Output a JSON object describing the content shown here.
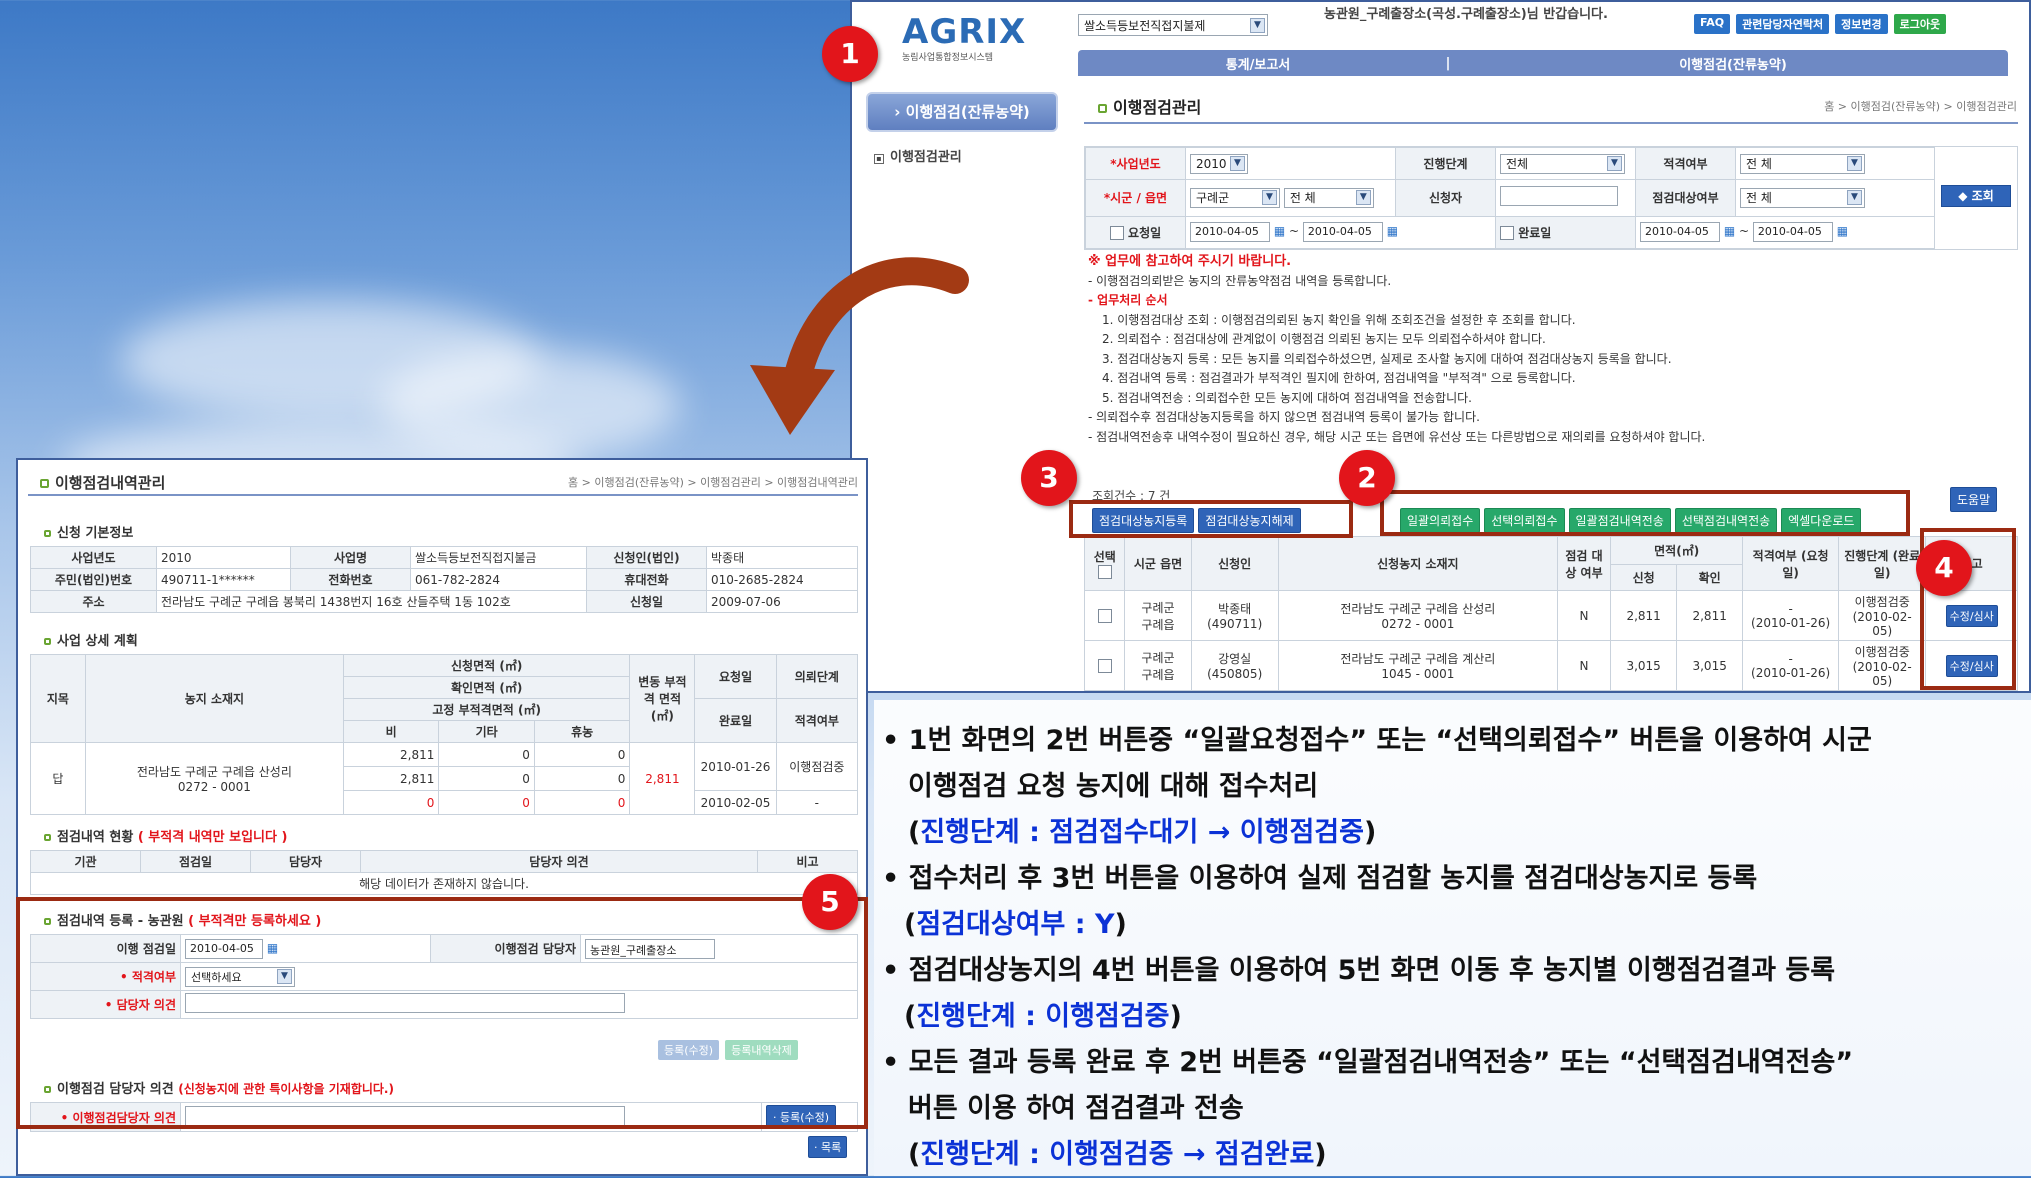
{
  "screen1": {
    "logo": "AGRIX",
    "logo_sub": "농림사업통합정보시스템",
    "program_select": "쌀소득등보전직접지불제",
    "greeting": "농관원_구례출장소(곡성.구례출장소)님 반갑습니다.",
    "top_buttons": [
      "FAQ",
      "관련담당자연락처",
      "정보변경",
      "로그아웃"
    ],
    "nav": [
      "통계/보고서",
      "|",
      "이행점검(잔류농약)"
    ],
    "side_menu_title": "› 이행점검(잔류농약)",
    "side_menu_item": "이행점검관리",
    "page_title": "이행점검관리",
    "breadcrumb": "홈 > 이행점검(잔류농약) > 이행점검관리",
    "filters": {
      "year_label": "*사업년도",
      "year": "2010",
      "stage_label": "진행단계",
      "stage": "전체",
      "fit_label": "적격여부",
      "fit": "전 체",
      "region_label": "*시군 / 읍면",
      "county": "구례군",
      "town": "전 체",
      "applicant_label": "신청자",
      "target_label": "점검대상여부",
      "target": "전 체",
      "req_date_label": "요청일",
      "req_from": "2010-04-05",
      "req_to": "2010-04-05",
      "done_date_label": "완료일",
      "done_from": "2010-04-05",
      "done_to": "2010-04-05",
      "tilde": "~",
      "search_btn": "조회"
    },
    "notice_title": "※ 업무에 참고하여 주시기 바랍니다.",
    "notice_lines": [
      "- 이행점검의뢰받은 농지의 잔류농약점검 내역을 등록합니다.",
      "- 업무처리 순서",
      "1. 이행점검대상 조회 : 이행점검의뢰된 농지 확인을 위해 조회조건을 설정한 후 조회를 합니다.",
      "2. 의뢰접수 : 점검대상에 관계없이 이행점검 의뢰된 농지는 모두 의뢰접수하셔야 합니다.",
      "3. 점검대상농지 등록 : 모든 농지를 의뢰접수하셨으면, 실제로 조사할 농지에 대하여 점검대상농지 등록을 합니다.",
      "4. 점검내역 등록 : 점검결과가 부적격인 필지에 한하여, 점검내역을 \"부적격\" 으로 등록합니다.",
      "5. 점검내역전송 : 의뢰접수한 모든 농지에 대하여 점검내역을 전송합니다.",
      "- 의뢰접수후 점검대상농지등록을 하지 않으면 점검내역 등록이 불가능 합니다.",
      "- 점검내역전송후 내역수정이 필요하신 경우, 해당 시군 또는 읍면에 유선상 또는 다른방법으로 재의뢰를 요청하셔야 합니다."
    ],
    "count_text": "조회건수 : 7 건",
    "help_btn": "도움말",
    "btn_group3": [
      "점검대상농지등록",
      "점검대상농지해제"
    ],
    "btn_group2": [
      "일괄의뢰접수",
      "선택의뢰접수",
      "일괄점검내역전송",
      "선택점검내역전송"
    ],
    "excel_btn": "엑셀다운로드",
    "table_headers": {
      "select": "선택",
      "county": "시군 읍면",
      "applicant": "신청인",
      "location": "신청농지 소재지",
      "target": "점검 대상 여부",
      "area": "면적(㎡)",
      "area_req": "신청",
      "area_conf": "확인",
      "fit": "적격여부 (요청일)",
      "stage": "진행단계 (완료일)",
      "note": "비고"
    },
    "rows": [
      {
        "county": "구례군",
        "town": "구례읍",
        "name": "박종태",
        "id": "(490711)",
        "loc1": "전라남도 구례군 구례읍 산성리",
        "loc2": "0272 - 0001",
        "target": "N",
        "req": "2,811",
        "conf": "2,811",
        "fit": "-",
        "fitdate": "(2010-01-26)",
        "stage": "이행점검중",
        "stagedate": "(2010-02-05)",
        "action": "수정/심사"
      },
      {
        "county": "구례군",
        "town": "구례읍",
        "name": "강영실",
        "id": "(450805)",
        "loc1": "전라남도 구례군 구례읍 계산리",
        "loc2": "1045 - 0001",
        "target": "N",
        "req": "3,015",
        "conf": "3,015",
        "fit": "-",
        "fitdate": "(2010-01-26)",
        "stage": "이행점검중",
        "stagedate": "(2010-02-05)",
        "action": "수정/심사"
      }
    ]
  },
  "screen5": {
    "page_title": "이행점검내역관리",
    "breadcrumb": "홈 > 이행점검(잔류농약) > 이행점검관리 > 이행점검내역관리",
    "sec_basic": "신청 기본정보",
    "basic": {
      "year_l": "사업년도",
      "year": "2010",
      "biz_l": "사업명",
      "biz": "쌀소득등보전직접지불금",
      "app_l": "신청인(법인)",
      "app": "박종태",
      "rrn_l": "주민(법인)번호",
      "rrn": "490711-1******",
      "tel_l": "전화번호",
      "tel": "061-782-2824",
      "mobile_l": "휴대전화",
      "mobile": "010-2685-2824",
      "addr_l": "주소",
      "addr": "전라남도 구례군 구례읍 봉북리 1438번지 16호 산들주택 1동 102호",
      "date_l": "신청일",
      "date": "2009-07-06"
    },
    "sec_plan": "사업 상세 계획",
    "plan_headers": {
      "jimok": "지목",
      "loc": "농지 소재지",
      "area_req": "신청면적 (㎡)",
      "area_conf": "확인면적 (㎡)",
      "area_fixed": "고정 부적격면적 (㎡)",
      "bi": "비",
      "etc": "기타",
      "hyu": "휴농",
      "change": "변동 부적격 면적 (㎡)",
      "req_date": "요청일",
      "done_date": "완료일",
      "stage": "의뢰단계",
      "fit": "적격여부"
    },
    "plan_row": {
      "jimok": "답",
      "loc1": "전라남도 구례군 구례읍 산성리",
      "loc2": "0272 - 0001",
      "r1": [
        "2,811",
        "0",
        "0"
      ],
      "r2": [
        "2,811",
        "0",
        "0"
      ],
      "r3": [
        "0",
        "0",
        "0"
      ],
      "change": "2,811",
      "req_date": "2010-01-26",
      "done_date": "2010-02-05",
      "stage": "이행점검중",
      "fit": "-"
    },
    "sec_status": "점검내역 현황",
    "sec_status_note": "( 부적격 내역만 보입니다 )",
    "status_headers": [
      "기관",
      "점검일",
      "담당자",
      "담당자 의견",
      "비고"
    ],
    "status_empty": "해당 데이터가 존재하지 않습니다.",
    "sec_reg": "점검내역 등록 - 농관원",
    "sec_reg_note": "( 부적격만 등록하세요 )",
    "reg": {
      "date_l": "이행 점검일",
      "date": "2010-04-05",
      "mgr_l": "이행점검 담당자",
      "mgr": "농관원_구례출장소",
      "fit_l": "• 적격여부",
      "fit": "선택하세요",
      "opinion_l": "• 담당자 의견"
    },
    "reg_btns": [
      "등록(수정)",
      "등록내역삭제"
    ],
    "sec_mgr": "이행점검 담당자 의견",
    "sec_mgr_note": "(신청농지에 관한 특이사항을 기재합니다.)",
    "mgr_l": "• 이행점검담당자 의견",
    "mgr_btn": "· 등록(수정)",
    "list_btn": "· 목록"
  },
  "markers": [
    "1",
    "2",
    "3",
    "4",
    "5"
  ],
  "instructions": [
    {
      "text": "• 1번 화면의 2번 버튼중 “일괄요청접수” 또는 “선택의뢰접수” 버튼을 이용하여 시군"
    },
    {
      "text": "이행점검 요청 농지에 대해 접수처리"
    },
    {
      "pre": "(",
      "blue": "진행단계 : 점검접수대기 → 이행점검중",
      "post": ")"
    },
    {
      "text": "• 접수처리 후 3번 버튼을 이용하여 실제 점검할 농지를 점검대상농지로 등록"
    },
    {
      "pre": "(",
      "blue": "점검대상여부 : Y",
      "post": ")"
    },
    {
      "text": "• 점검대상농지의 4번 버튼을 이용하여 5번 화면 이동 후 농지별 이행점검결과 등록"
    },
    {
      "pre": "(",
      "blue": "진행단계 : 이행점검중",
      "post": ")"
    },
    {
      "text": "• 모든 결과 등록 완료 후 2번 버튼중 “일괄점검내역전송” 또는 “선택점검내역전송”"
    },
    {
      "text": "버튼 이용 하여 점검결과 전송"
    },
    {
      "pre": "(",
      "blue": "진행단계 : 이행점검중 → 점검완료",
      "post": ")"
    }
  ],
  "colors": {
    "marker": "#e2151b",
    "highlight": "#9b2a12",
    "arrow": "#a33a14",
    "blue_text": "#0b32d6",
    "nav": "#6e89c4",
    "green_btn": "#27a86a",
    "blue_btn": "#2f64b8"
  }
}
